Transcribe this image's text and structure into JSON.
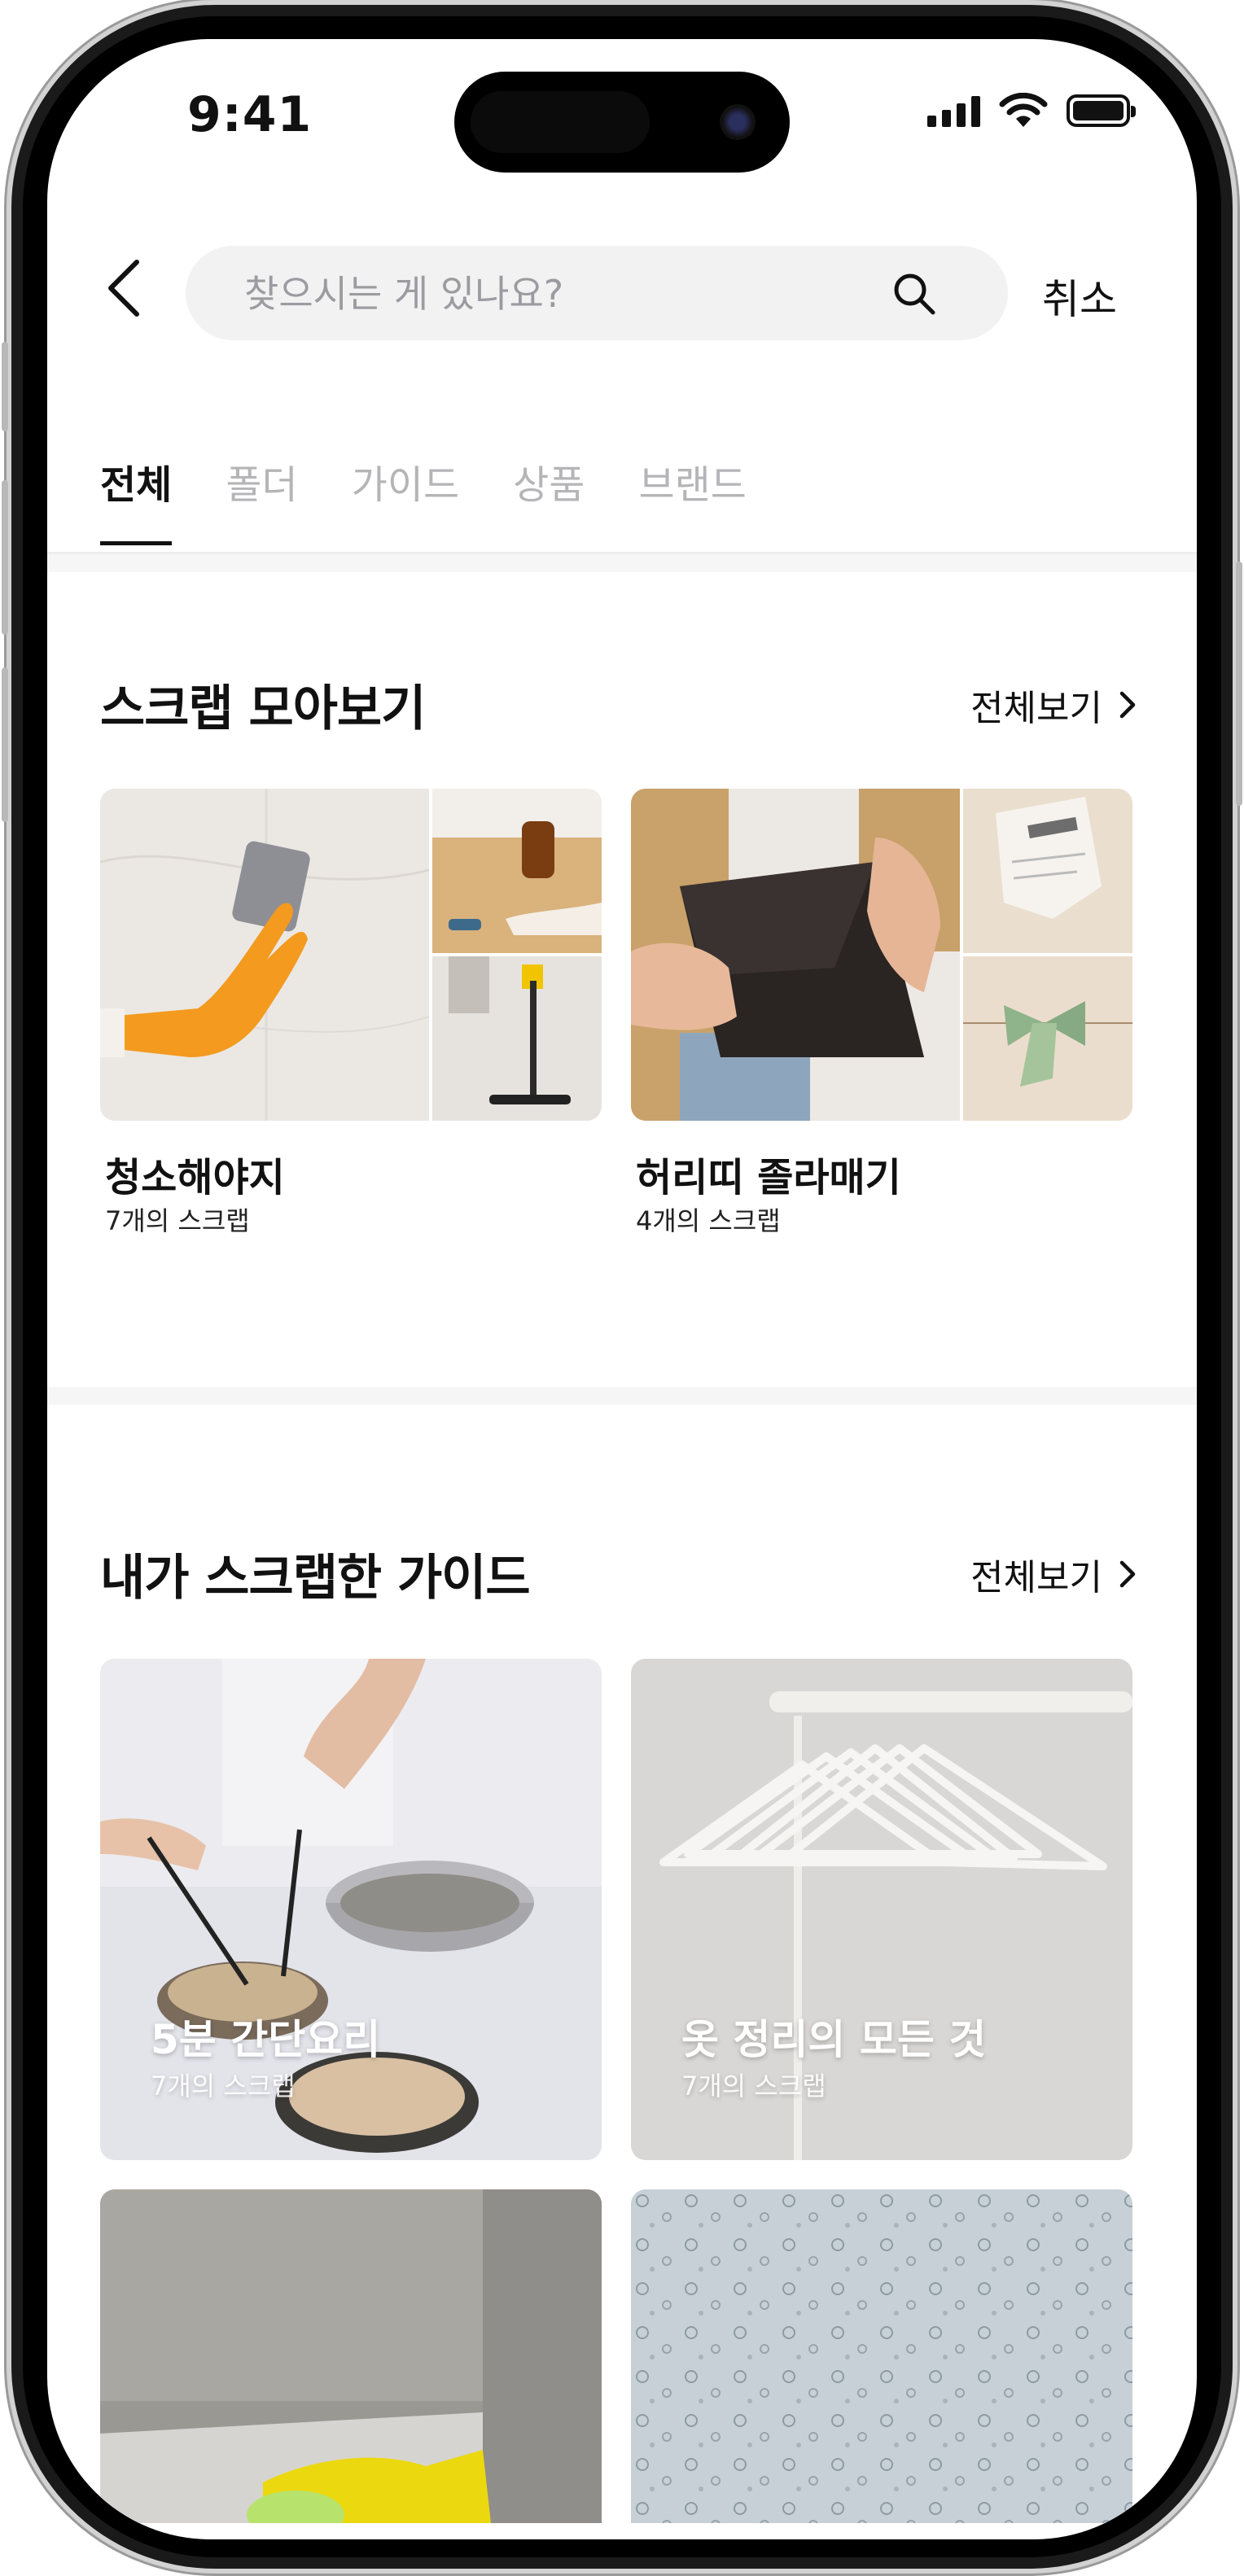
{
  "status_bar": {
    "time": "9:41"
  },
  "search": {
    "placeholder": "찾으시는 게 있나요?",
    "value": "",
    "cancel_label": "취소"
  },
  "tabs": [
    {
      "label": "전체",
      "active": true
    },
    {
      "label": "폴더",
      "active": false
    },
    {
      "label": "가이드",
      "active": false
    },
    {
      "label": "상품",
      "active": false
    },
    {
      "label": "브랜드",
      "active": false
    }
  ],
  "scrap_section": {
    "title": "스크랩 모아보기",
    "see_all_label": "전체보기",
    "folders": [
      {
        "name": "청소해야지",
        "count": "7개의 스크랩"
      },
      {
        "name": "허리띠 졸라매기",
        "count": "4개의 스크랩"
      }
    ]
  },
  "guide_section": {
    "title": "내가 스크랩한 가이드",
    "see_all_label": "전체보기",
    "guides": [
      {
        "title": "5분 간단요리",
        "count": "7개의 스크랩"
      },
      {
        "title": "옷 정리의 모든 것",
        "count": "7개의 스크랩"
      }
    ]
  },
  "colors": {
    "accent_text": "#111111",
    "muted_tab": "#b5b5b8",
    "search_bg": "#f2f2f3"
  }
}
